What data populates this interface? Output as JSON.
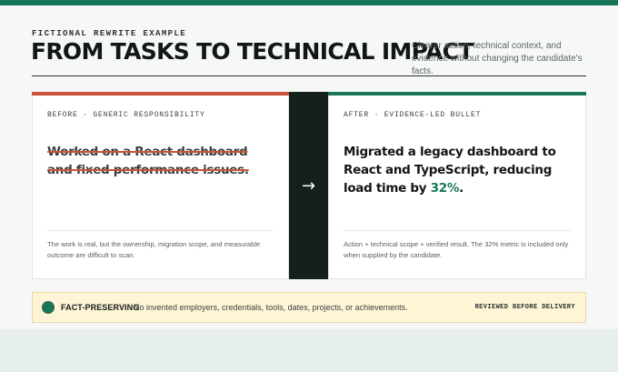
{
  "header": {
    "eyebrow": "FICTIONAL REWRITE EXAMPLE",
    "title": "FROM TASKS TO TECHNICAL IMPACT",
    "subtitle": "Clearer action, technical context, and evidence without changing the candidate's facts."
  },
  "before": {
    "label": "BEFORE · GENERIC RESPONSIBILITY",
    "statement": "Worked on a React dashboard and fixed performance issues.",
    "note": "The work is real, but the ownership, migration scope, and measurable outcome are difficult to scan."
  },
  "arrow": {
    "glyph": "→"
  },
  "after": {
    "label": "AFTER · EVIDENCE-LED BULLET",
    "statement_prefix": "Migrated a legacy dashboard to React and TypeScript, reducing load time by ",
    "statement_highlight": "32%",
    "statement_suffix": ".",
    "note": "Action + technical scope + verified result. The 32% metric is included only when supplied by the candidate."
  },
  "banner": {
    "tag": "FACT-PRESERVING",
    "message": "No invented employers, credentials, tools, dates, projects, or achievements.",
    "status": "REVIEWED BEFORE DELIVERY"
  },
  "colors": {
    "accent_green": "#18775a",
    "accent_red": "#c9533b",
    "dark": "#15201b",
    "banner_bg": "#fdf5d6"
  }
}
